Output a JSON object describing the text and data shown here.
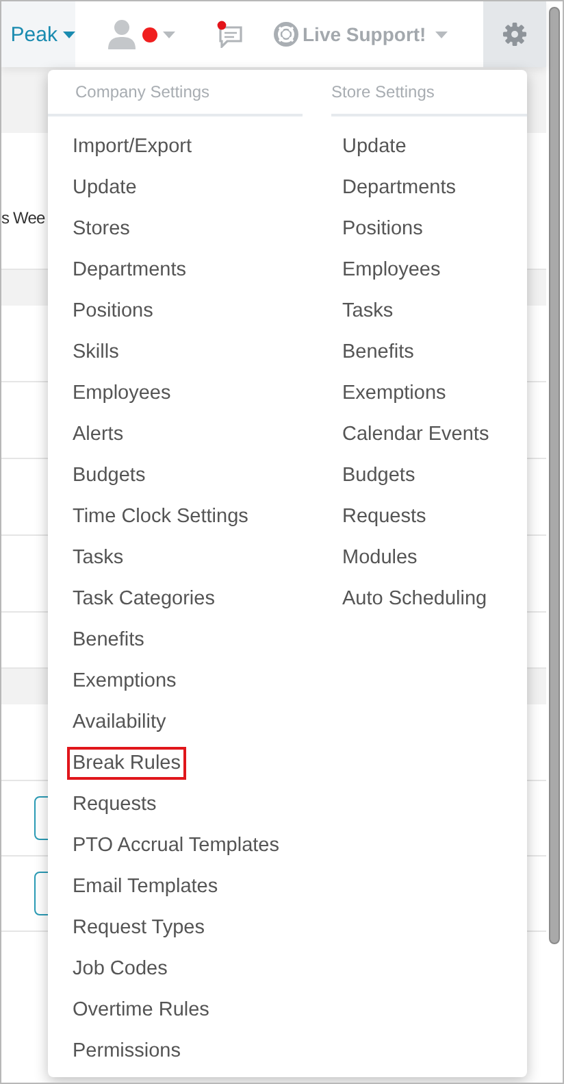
{
  "top_bar": {
    "store_menu": {
      "label": "Peak"
    },
    "live_support": {
      "label": "Live Support!"
    }
  },
  "background": {
    "week_text": "s Wee"
  },
  "settings_menu": {
    "columns": [
      {
        "heading": "Company Settings",
        "items": [
          {
            "label": "Import/Export",
            "highlighted": false
          },
          {
            "label": "Update",
            "highlighted": false
          },
          {
            "label": "Stores",
            "highlighted": false
          },
          {
            "label": "Departments",
            "highlighted": false
          },
          {
            "label": "Positions",
            "highlighted": false
          },
          {
            "label": "Skills",
            "highlighted": false
          },
          {
            "label": "Employees",
            "highlighted": false
          },
          {
            "label": "Alerts",
            "highlighted": false
          },
          {
            "label": "Budgets",
            "highlighted": false
          },
          {
            "label": "Time Clock Settings",
            "highlighted": false
          },
          {
            "label": "Tasks",
            "highlighted": false
          },
          {
            "label": "Task Categories",
            "highlighted": false
          },
          {
            "label": "Benefits",
            "highlighted": false
          },
          {
            "label": "Exemptions",
            "highlighted": false
          },
          {
            "label": "Availability",
            "highlighted": false
          },
          {
            "label": "Break Rules",
            "highlighted": true
          },
          {
            "label": "Requests",
            "highlighted": false
          },
          {
            "label": "PTO Accrual Templates",
            "highlighted": false
          },
          {
            "label": "Email Templates",
            "highlighted": false
          },
          {
            "label": "Request Types",
            "highlighted": false
          },
          {
            "label": "Job Codes",
            "highlighted": false
          },
          {
            "label": "Overtime Rules",
            "highlighted": false
          },
          {
            "label": "Permissions",
            "highlighted": false
          }
        ]
      },
      {
        "heading": "Store Settings",
        "items": [
          {
            "label": "Update",
            "highlighted": false
          },
          {
            "label": "Departments",
            "highlighted": false
          },
          {
            "label": "Positions",
            "highlighted": false
          },
          {
            "label": "Employees",
            "highlighted": false
          },
          {
            "label": "Tasks",
            "highlighted": false
          },
          {
            "label": "Benefits",
            "highlighted": false
          },
          {
            "label": "Exemptions",
            "highlighted": false
          },
          {
            "label": "Calendar Events",
            "highlighted": false
          },
          {
            "label": "Budgets",
            "highlighted": false
          },
          {
            "label": "Requests",
            "highlighted": false
          },
          {
            "label": "Modules",
            "highlighted": false
          },
          {
            "label": "Auto Scheduling",
            "highlighted": false
          }
        ]
      }
    ]
  }
}
